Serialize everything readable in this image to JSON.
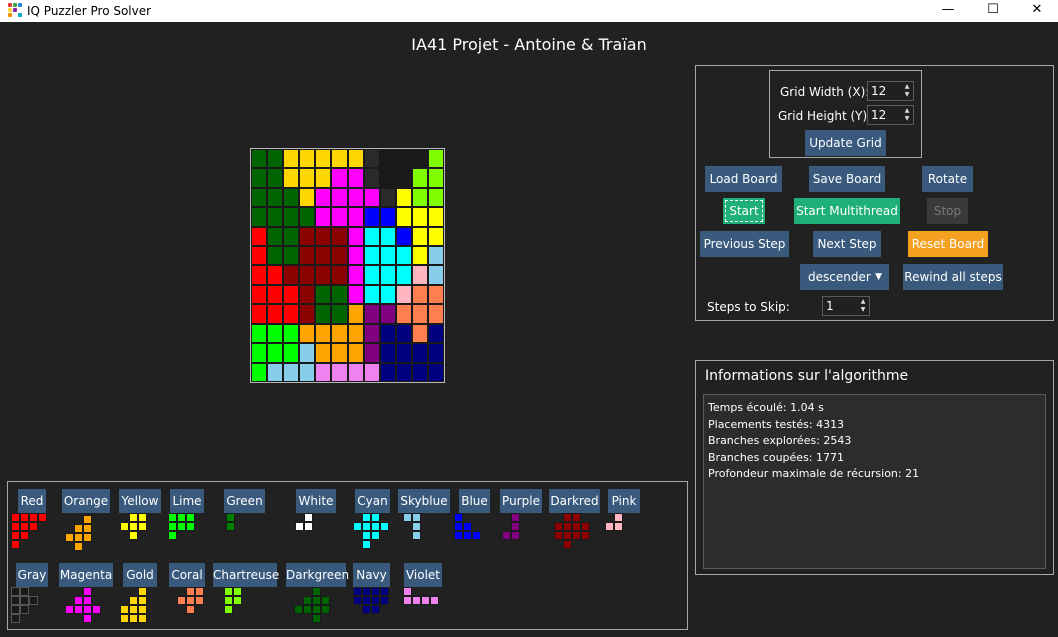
{
  "window": {
    "title": "IQ Puzzler Pro Solver",
    "minimize": "—",
    "maximize": "☐",
    "close": "✕"
  },
  "header": {
    "title": "IA41 Projet - Antoine & Traïan"
  },
  "colors": {
    "R": "#ff0000",
    "O": "#ffa500",
    "Y": "#ffff00",
    "L": "#00ff00",
    "G": "#008000",
    "W": "#ffffff",
    "C": "#00ffff",
    "S": "#87ceeb",
    "B": "#0000ff",
    "P": "#800080",
    "D": "#8b0000",
    "K": "#ffb6c1",
    "A": "#1a1a1a",
    "M": "#ff00ff",
    "U": "#ffd700",
    "Q": "#ff7f50",
    "H": "#7fff00",
    "E": "#006400",
    "N": "#000080",
    "V": "#ee82ee"
  },
  "board": {
    "rows": [
      "EEUUUUU.AAAH",
      "EEUUUMM.AAHH",
      "EEEUMMMM.YHH",
      "EEEEMMMBBYYY",
      "REEDDDMCCBYY",
      "REEDDDMCCCYS",
      "RRDDDDMCCCKS",
      "RRRDEEMCCKQQ",
      "RRRDEEOPPQQQ",
      "LLLOOOOPNNQN",
      "LLLSOOOPNNNN",
      "LSSSVVVVNNNN"
    ]
  },
  "controls": {
    "grid_width_label": "Grid Width (X):",
    "grid_width_value": "12",
    "grid_height_label": "Grid Height (Y):",
    "grid_height_value": "12",
    "update_grid": "Update Grid",
    "load_board": "Load Board",
    "save_board": "Save Board",
    "rotate": "Rotate",
    "start": "Start",
    "start_multithread": "Start Multithread",
    "stop": "Stop",
    "previous_step": "Previous Step",
    "next_step": "Next Step",
    "reset_board": "Reset Board",
    "order_select": "descender",
    "rewind": "Rewind all steps",
    "steps_to_skip_label": "Steps to Skip:",
    "steps_to_skip_value": "1"
  },
  "info": {
    "title": "Informations sur l'algorithme",
    "lines": [
      "Temps écoulé: 1.04 s",
      "Placements testés: 4313",
      "Branches explorées: 2543",
      "Branches coupées: 1771",
      "Profondeur maximale de récursion: 21"
    ]
  },
  "pieces": [
    {
      "label": "Red",
      "color": "#ff0000",
      "cells": [
        [
          0,
          0
        ],
        [
          1,
          0
        ],
        [
          2,
          0
        ],
        [
          3,
          0
        ],
        [
          0,
          1
        ],
        [
          1,
          1
        ],
        [
          2,
          1
        ],
        [
          0,
          2
        ],
        [
          1,
          2
        ],
        [
          0,
          3
        ]
      ]
    },
    {
      "label": "Orange",
      "color": "#ffa500",
      "cells": [
        [
          2,
          0
        ],
        [
          1,
          1
        ],
        [
          2,
          1
        ],
        [
          0,
          2
        ],
        [
          1,
          2
        ],
        [
          2,
          2
        ],
        [
          1,
          3
        ]
      ]
    },
    {
      "label": "Yellow",
      "color": "#ffff00",
      "cells": [
        [
          1,
          0
        ],
        [
          2,
          0
        ],
        [
          0,
          1
        ],
        [
          1,
          1
        ],
        [
          2,
          1
        ],
        [
          1,
          2
        ]
      ]
    },
    {
      "label": "Lime",
      "color": "#00ff00",
      "cells": [
        [
          0,
          0
        ],
        [
          1,
          0
        ],
        [
          2,
          0
        ],
        [
          0,
          1
        ],
        [
          1,
          1
        ],
        [
          2,
          1
        ],
        [
          0,
          2
        ]
      ]
    },
    {
      "label": "Green",
      "color": "#008000",
      "cells": [
        [
          0,
          0
        ],
        [
          0,
          1
        ]
      ]
    },
    {
      "label": "White",
      "color": "#ffffff",
      "cells": [
        [
          1,
          0
        ],
        [
          0,
          1
        ],
        [
          1,
          1
        ]
      ]
    },
    {
      "label": "Cyan",
      "color": "#00ffff",
      "cells": [
        [
          1,
          0
        ],
        [
          2,
          0
        ],
        [
          0,
          1
        ],
        [
          1,
          1
        ],
        [
          2,
          1
        ],
        [
          3,
          1
        ],
        [
          1,
          2
        ],
        [
          2,
          2
        ],
        [
          1,
          3
        ]
      ]
    },
    {
      "label": "Skyblue",
      "color": "#87ceeb",
      "cells": [
        [
          0,
          0
        ],
        [
          1,
          0
        ],
        [
          1,
          1
        ],
        [
          1,
          2
        ]
      ]
    },
    {
      "label": "Blue",
      "color": "#0000ff",
      "cells": [
        [
          0,
          0
        ],
        [
          0,
          1
        ],
        [
          1,
          1
        ],
        [
          0,
          2
        ],
        [
          1,
          2
        ],
        [
          2,
          2
        ]
      ]
    },
    {
      "label": "Purple",
      "color": "#800080",
      "cells": [
        [
          1,
          0
        ],
        [
          1,
          1
        ],
        [
          0,
          2
        ],
        [
          1,
          2
        ]
      ]
    },
    {
      "label": "Darkred",
      "color": "#8b0000",
      "cells": [
        [
          1,
          0
        ],
        [
          2,
          0
        ],
        [
          0,
          1
        ],
        [
          1,
          1
        ],
        [
          2,
          1
        ],
        [
          3,
          1
        ],
        [
          0,
          2
        ],
        [
          1,
          2
        ],
        [
          2,
          2
        ],
        [
          3,
          2
        ],
        [
          1,
          3
        ]
      ]
    },
    {
      "label": "Pink",
      "color": "#ffb6c1",
      "cells": [
        [
          1,
          0
        ],
        [
          0,
          1
        ],
        [
          1,
          1
        ]
      ]
    },
    {
      "label": "Gray",
      "color": "#1a1a1a",
      "cells": [
        [
          0,
          0
        ],
        [
          1,
          0
        ],
        [
          0,
          1
        ],
        [
          1,
          1
        ],
        [
          2,
          1
        ],
        [
          0,
          2
        ],
        [
          1,
          2
        ],
        [
          0,
          3
        ]
      ]
    },
    {
      "label": "Magenta",
      "color": "#ff00ff",
      "cells": [
        [
          2,
          0
        ],
        [
          1,
          1
        ],
        [
          2,
          1
        ],
        [
          0,
          2
        ],
        [
          1,
          2
        ],
        [
          2,
          2
        ],
        [
          3,
          2
        ],
        [
          2,
          3
        ]
      ]
    },
    {
      "label": "Gold",
      "color": "#ffd700",
      "cells": [
        [
          2,
          0
        ],
        [
          1,
          1
        ],
        [
          2,
          1
        ],
        [
          0,
          2
        ],
        [
          1,
          2
        ],
        [
          2,
          2
        ],
        [
          0,
          3
        ],
        [
          1,
          3
        ],
        [
          2,
          3
        ]
      ]
    },
    {
      "label": "Coral",
      "color": "#ff7f50",
      "cells": [
        [
          1,
          0
        ],
        [
          2,
          0
        ],
        [
          0,
          1
        ],
        [
          1,
          1
        ],
        [
          2,
          1
        ],
        [
          1,
          2
        ]
      ]
    },
    {
      "label": "Chartreuse",
      "color": "#7fff00",
      "cells": [
        [
          0,
          0
        ],
        [
          1,
          0
        ],
        [
          0,
          1
        ],
        [
          1,
          1
        ],
        [
          0,
          2
        ]
      ]
    },
    {
      "label": "Darkgreen",
      "color": "#006400",
      "cells": [
        [
          2,
          0
        ],
        [
          1,
          1
        ],
        [
          2,
          1
        ],
        [
          3,
          1
        ],
        [
          0,
          2
        ],
        [
          1,
          2
        ],
        [
          2,
          2
        ],
        [
          3,
          2
        ],
        [
          2,
          3
        ]
      ]
    },
    {
      "label": "Navy",
      "color": "#000080",
      "cells": [
        [
          0,
          0
        ],
        [
          1,
          0
        ],
        [
          2,
          0
        ],
        [
          3,
          0
        ],
        [
          0,
          1
        ],
        [
          1,
          1
        ],
        [
          2,
          1
        ],
        [
          3,
          1
        ],
        [
          1,
          2
        ],
        [
          2,
          2
        ]
      ]
    },
    {
      "label": "Violet",
      "color": "#ee82ee",
      "cells": [
        [
          0,
          0
        ],
        [
          0,
          1
        ],
        [
          1,
          1
        ],
        [
          2,
          1
        ],
        [
          3,
          1
        ]
      ]
    }
  ]
}
